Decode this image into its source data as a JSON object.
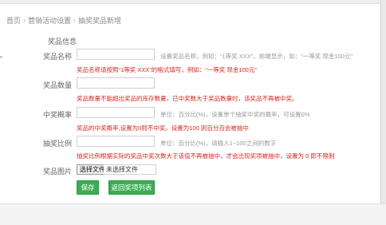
{
  "breadcrumb": {
    "items": [
      "首页",
      "营销活动设置",
      "抽奖奖品新增"
    ]
  },
  "section_title": "奖品信息",
  "fields": {
    "prize_name": {
      "label": "奖品名称",
      "value": "",
      "hint": "设置奖品名称，例如：“1等奖 XXX”，前端显示，如：“一等奖 现金100元”",
      "warning": "奖品名称请按照“1等奖 XXX”的格式填写，例如：“一等奖 现金100元”"
    },
    "prize_count": {
      "label": "奖品数量",
      "value": "",
      "warning": "奖品数量不能超出奖品的库存数量，已中奖数大于奖品数量时，该奖品不再被中奖。"
    },
    "win_rate": {
      "label": "中奖概率",
      "value": "",
      "hint": "单位：百分比(%)，设置单个抽奖中奖的概率，可设置0%",
      "warning": "奖品的中奖概率,设置为0则不中奖，设置为100 则百分百会被抽中"
    },
    "draw_ratio": {
      "label": "抽奖比例",
      "value": "",
      "hint": "单位：百分比(%)，请输入1~100之间的数字",
      "warning": "抽奖比例根据实际的奖品中奖次数大于该值不再被抽中，才会出现奖项被抽中，设置为 0 即不限制"
    },
    "prize_image": {
      "label": "奖品图片",
      "button_label": "选择文件",
      "status": "未选择文件"
    }
  },
  "actions": {
    "save_label": "保存",
    "back_label": "返回奖项列表"
  },
  "colors": {
    "accent_green": "#3bae54",
    "warning_red": "#e0261c"
  }
}
